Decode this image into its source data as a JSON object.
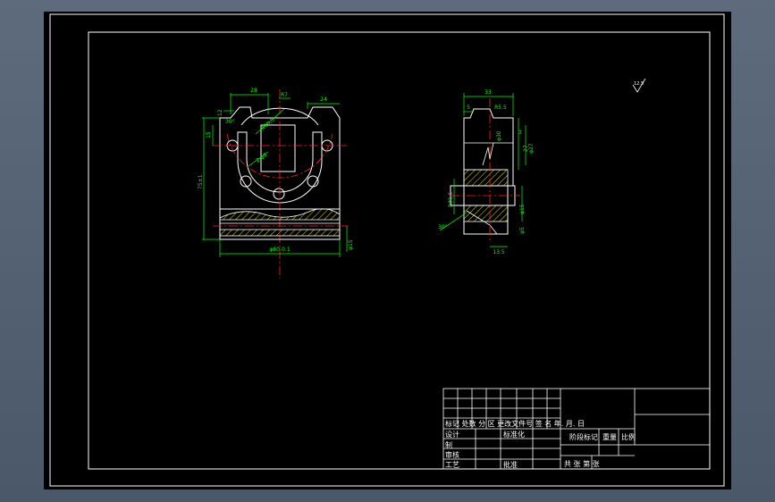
{
  "drawing": {
    "colors": {
      "background": "#000000",
      "frame": "#ffffff",
      "geometry": "#ffffff",
      "dimension": "#00ff00",
      "centerline": "#ff2020",
      "hatch": "#ffff00"
    },
    "front_view": {
      "dims": {
        "top_left": "28",
        "top_center": "R7",
        "top_right": "24",
        "left_small": "12",
        "left_upper": "15",
        "left_total": "75±1",
        "angle": "30°",
        "radius": "R40.5",
        "hole_label": "2-φ8",
        "bottom": "φ80-0.1",
        "right_small": "φ15"
      }
    },
    "side_view": {
      "dims": {
        "top": "33",
        "left_small": "5",
        "top_mid": "R5.5",
        "right_a": "3",
        "right_b": "27",
        "right_c": "φ27",
        "right_d": "φ15",
        "right_e": "φ5",
        "left_depth": "R31.5",
        "mid": "φ30",
        "angle": "30°",
        "bottom": "13.5"
      }
    },
    "roughness": "12.5",
    "title_block": {
      "row_label": "标记 处数 分 区 更改文件号 签 名 年. 月. 日",
      "design": "设计",
      "standardize": "标准化",
      "stage_mark": "阶段标记",
      "weight": "重量",
      "scale": "比例",
      "draw": "制",
      "review": "审核",
      "process": "工艺",
      "approve": "批准",
      "sheets": "共   张 第   张"
    }
  }
}
